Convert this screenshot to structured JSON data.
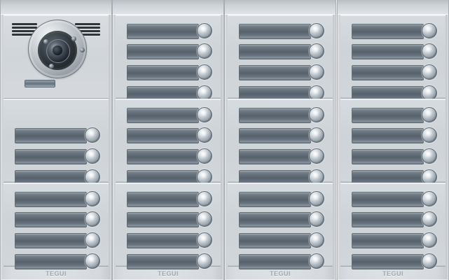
{
  "brand_text": [
    "TEGUI",
    "TEGUI",
    "TEGUI",
    "TEGUI"
  ],
  "camera": {
    "speaker_icon": "speaker-grille-icon",
    "camera_icon": "camera-icon"
  },
  "panel": {
    "column_count": 4,
    "button_count": 44
  }
}
